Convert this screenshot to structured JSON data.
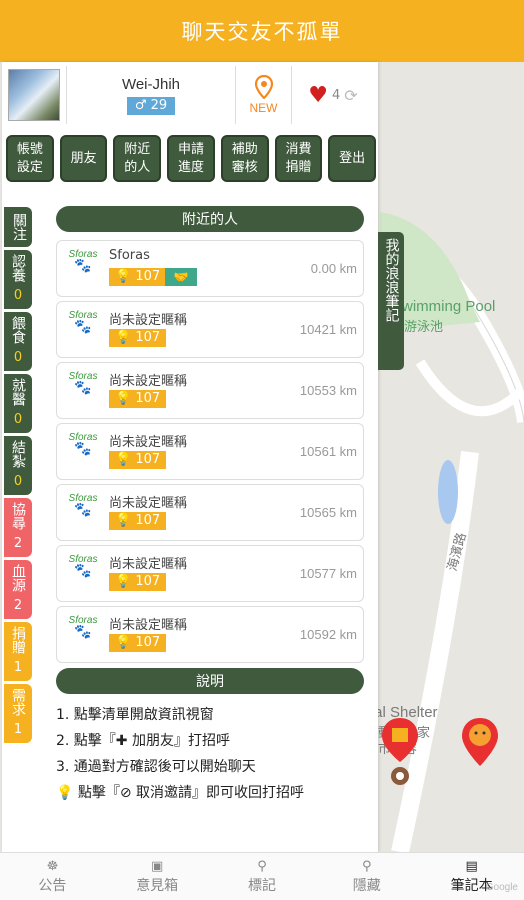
{
  "header": {
    "title": "聊天交友不孤單"
  },
  "profile": {
    "name": "Wei-Jhih",
    "gender_icon": "male-icon",
    "age": "♂ 29",
    "new_label": "NEW",
    "likes": "4"
  },
  "buttons": [
    {
      "label": "帳號\n設定"
    },
    {
      "label": "朋友"
    },
    {
      "label": "附近\n的人"
    },
    {
      "label": "申請\n進度"
    },
    {
      "label": "補助\n審核"
    },
    {
      "label": "消費\n捐贈"
    },
    {
      "label": "登出"
    }
  ],
  "side_tabs": [
    {
      "label": "關注",
      "count": ""
    },
    {
      "label": "認養",
      "count": "0"
    },
    {
      "label": "餵食",
      "count": "0"
    },
    {
      "label": "就醫",
      "count": "0"
    },
    {
      "label": "結紮",
      "count": "0"
    },
    {
      "label": "協尋",
      "count": "2"
    },
    {
      "label": "血源",
      "count": "2"
    },
    {
      "label": "捐贈",
      "count": "1"
    },
    {
      "label": "需求",
      "count": "1"
    }
  ],
  "nearby": {
    "title": "附近的人",
    "logo_text": "Sforas",
    "people": [
      {
        "name": "Sforas",
        "score": "107",
        "distance": "0.00 km",
        "handshake": true
      },
      {
        "name": "尚未設定暱稱",
        "score": "107",
        "distance": "10421 km",
        "handshake": false
      },
      {
        "name": "尚未設定暱稱",
        "score": "107",
        "distance": "10553 km",
        "handshake": false
      },
      {
        "name": "尚未設定暱稱",
        "score": "107",
        "distance": "10561 km",
        "handshake": false
      },
      {
        "name": "尚未設定暱稱",
        "score": "107",
        "distance": "10565 km",
        "handshake": false
      },
      {
        "name": "尚未設定暱稱",
        "score": "107",
        "distance": "10577 km",
        "handshake": false
      },
      {
        "name": "尚未設定暱稱",
        "score": "107",
        "distance": "10592 km",
        "handshake": false
      }
    ]
  },
  "explain": {
    "title": "說明",
    "lines": [
      "1. 點擊清單開啟資訊視窗",
      "2. 點擊『✚ 加朋友』打招呼",
      "3. 通過對方確認後可以開始聊天",
      "💡 點擊『⊘ 取消邀請』即可收回打招呼"
    ]
  },
  "memo": {
    "label": "我的浪浪筆記"
  },
  "map": {
    "labels": [
      "Swimming Pool",
      "游泳池",
      "Animal Shelter",
      "流浪動物之家",
      "新竹市收容",
      "海濱路"
    ]
  },
  "bottom_nav": [
    {
      "label": "公告",
      "icon": "announce-icon"
    },
    {
      "label": "意見箱",
      "icon": "box-icon"
    },
    {
      "label": "標記",
      "icon": "pin-icon"
    },
    {
      "label": "隱藏",
      "icon": "pin-icon"
    },
    {
      "label": "筆記本",
      "icon": "notebook-icon"
    }
  ],
  "map_footer": "Google",
  "colors": {
    "accent": "#f5b120",
    "green": "#3f5a3d",
    "red": "#f06468"
  }
}
